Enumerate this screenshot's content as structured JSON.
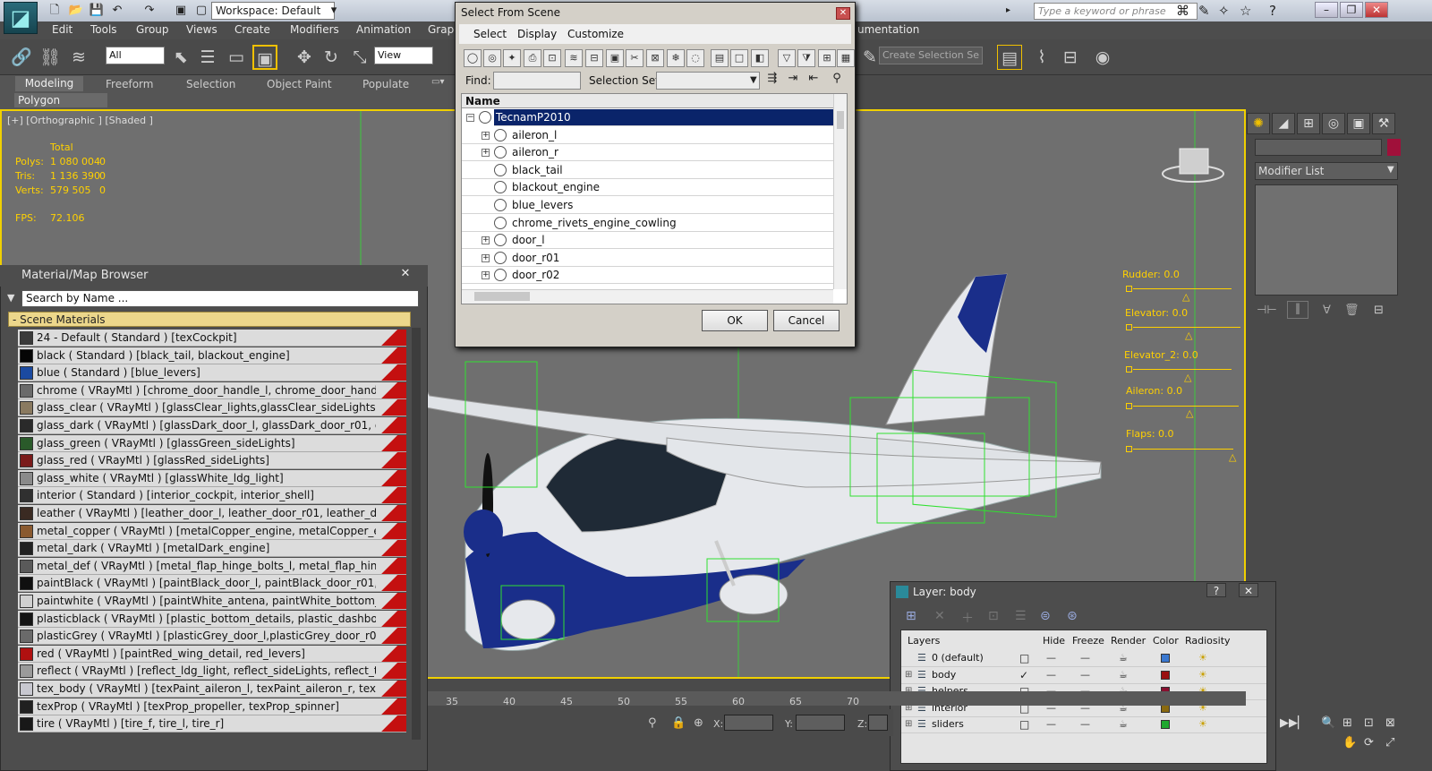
{
  "app": {
    "workspace": "Workspace: Default",
    "search_placeholder": "Type a keyword or phrase"
  },
  "menus": [
    "Edit",
    "Tools",
    "Group",
    "Views",
    "Create",
    "Modifiers",
    "Animation",
    "Graph",
    "umentation"
  ],
  "toolbar": {
    "selection_filter": "All",
    "reference_coord": "View",
    "named_selection": "Create Selection Se"
  },
  "ribbon": {
    "tabs": [
      "Modeling",
      "Freeform",
      "Selection",
      "Object Paint",
      "Populate"
    ],
    "panel": "Polygon Modeling"
  },
  "viewport": {
    "label": "[+] [Orthographic ] [Shaded ]",
    "stats_header": "Total",
    "stats": [
      {
        "label": "Polys:",
        "value": "1 080 004",
        "sel": "0"
      },
      {
        "label": "Tris:",
        "value": "1 136 390",
        "sel": "0"
      },
      {
        "label": "Verts:",
        "value": "579 505",
        "sel": "0"
      }
    ],
    "fps_label": "FPS:",
    "fps_value": "72.106",
    "sliders": [
      {
        "label": "Rudder: 0.0"
      },
      {
        "label": "Elevator: 0.0"
      },
      {
        "label": "Elevator_2: 0.0"
      },
      {
        "label": "Aileron: 0.0"
      },
      {
        "label": "Flaps: 0.0"
      }
    ],
    "ruler": [
      "35",
      "40",
      "45",
      "50",
      "55",
      "60",
      "65",
      "70"
    ]
  },
  "material_browser": {
    "title": "Material/Map Browser",
    "close": "✕",
    "search_placeholder": "Search by Name ...",
    "group": "- Scene Materials",
    "items": [
      {
        "text": "24 - Default  ( Standard )  [texCockpit]",
        "color": "#3a3a3a"
      },
      {
        "text": "black  ( Standard )  [black_tail, blackout_engine]",
        "color": "#050505"
      },
      {
        "text": "blue  ( Standard )  [blue_levers]",
        "color": "#1b4aa0"
      },
      {
        "text": "chrome  ( VRayMtl )  [chrome_door_handle_l, chrome_door_handle_r01, chrome",
        "color": "#6a6a6a"
      },
      {
        "text": "glass_clear  ( VRayMtl )  [glassClear_lights,glassClear_sideLights]",
        "color": "#8a7a60"
      },
      {
        "text": "glass_dark  ( VRayMtl )  [glassDark_door_l, glassDark_door_r01, glassDark_doo",
        "color": "#2a2a2a"
      },
      {
        "text": "glass_green  ( VRayMtl )  [glassGreen_sideLights]",
        "color": "#2a5a2a"
      },
      {
        "text": "glass_red  ( VRayMtl )  [glassRed_sideLights]",
        "color": "#7a1a1a"
      },
      {
        "text": "glass_white  ( VRayMtl )  [glassWhite_ldg_light]",
        "color": "#8a8a8a"
      },
      {
        "text": "interior  ( Standard )  [interior_cockpit, interior_shell]",
        "color": "#303030"
      },
      {
        "text": "leather  ( VRayMtl )  [leather_door_l, leather_door_r01, leather_door_r02, leathe",
        "color": "#3a2a22"
      },
      {
        "text": "metal_copper  ( VRayMtl )  [metalCopper_engine, metalCopper_exhaust, metalC",
        "color": "#8a5a30"
      },
      {
        "text": "metal_dark  ( VRayMtl )  [metalDark_engine]",
        "color": "#222222"
      },
      {
        "text": "metal_def  ( VRayMtl )  [metal_flap_hinge_bolts_l, metal_flap_hinge_bolts_r, me",
        "color": "#5a5a5a"
      },
      {
        "text": "paintBlack  ( VRayMtl )  [paintBlack_door_l, paintBlack_door_r01, paintBlack_doo",
        "color": "#101010"
      },
      {
        "text": "paintwhite  ( VRayMtl )  [paintWhite_antena, paintWhite_bottom_details, paintW...",
        "color": "#d0d0d0"
      },
      {
        "text": "plasticblack  ( VRayMtl )  [plastic_bottom_details, plastic_dashboard, plastic_foot",
        "color": "#151515"
      },
      {
        "text": "plasticGrey  ( VRayMtl )  [plasticGrey_door_l,plasticGrey_door_r01, plasticGrey",
        "color": "#6a6a6a"
      },
      {
        "text": "red  ( VRayMtl )  [paintRed_wing_detail, red_levers]",
        "color": "#b01010"
      },
      {
        "text": "reflect  ( VRayMtl )  [reflect_ldg_light, reflect_sideLights, reflect_taillights]",
        "color": "#9a9a9a"
      },
      {
        "text": "tex_body  ( VRayMtl )  [texPaint_aileron_l, texPaint_aileron_r, texPaint_door_l, te",
        "color": "#c8c8d0"
      },
      {
        "text": "texProp  ( VRayMtl )  [texProp_propeller, texProp_spinner]",
        "color": "#202020"
      },
      {
        "text": "tire  ( VRayMtl )  [tire_f, tire_l, tire_r]",
        "color": "#181818"
      }
    ]
  },
  "select_from_scene": {
    "title": "Select From Scene",
    "menus": [
      "Select",
      "Display",
      "Customize"
    ],
    "find_label": "Find:",
    "selset_label": "Selection Set:",
    "column": "Name",
    "items": [
      {
        "name": "TecnamP2010",
        "expander": "−",
        "selected": true
      },
      {
        "name": "aileron_l",
        "expander": "+"
      },
      {
        "name": "aileron_r",
        "expander": "+"
      },
      {
        "name": "black_tail",
        "expander": ""
      },
      {
        "name": "blackout_engine",
        "expander": ""
      },
      {
        "name": "blue_levers",
        "expander": ""
      },
      {
        "name": "chrome_rivets_engine_cowling",
        "expander": ""
      },
      {
        "name": "door_l",
        "expander": "+"
      },
      {
        "name": "door_r01",
        "expander": "+"
      },
      {
        "name": "door_r02",
        "expander": "+"
      }
    ],
    "ok": "OK",
    "cancel": "Cancel"
  },
  "command_panel": {
    "modifier_list": "Modifier List",
    "object_color": "#a0103a"
  },
  "layer_dialog": {
    "title": "Layer: body",
    "help": "?",
    "close": "✕",
    "columns": [
      "Layers",
      "Hide",
      "Freeze",
      "Render",
      "Color",
      "Radiosity"
    ],
    "layers": [
      {
        "name": "0 (default)",
        "color": "#3a78d0",
        "current": false
      },
      {
        "name": "body",
        "color": "#9a1010",
        "current": true
      },
      {
        "name": "helpers",
        "color": "#8a1030",
        "current": false
      },
      {
        "name": "interior",
        "color": "#8a6a10",
        "current": false
      },
      {
        "name": "sliders",
        "color": "#20a830",
        "current": false
      }
    ]
  },
  "status": {
    "x_label": "X:",
    "y_label": "Y:",
    "z_label": "Z:"
  }
}
